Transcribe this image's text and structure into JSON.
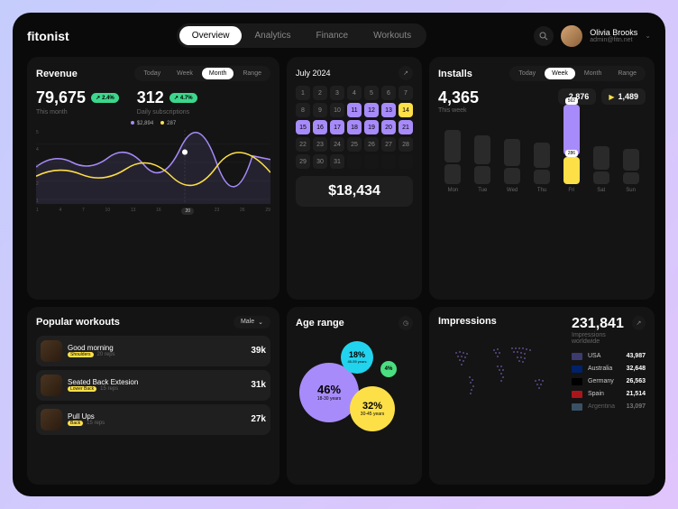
{
  "brand": "fitonist",
  "nav": {
    "items": [
      "Overview",
      "Analytics",
      "Finance",
      "Workouts"
    ],
    "active": 0
  },
  "user": {
    "name": "Olivia Brooks",
    "email": "admin@fitn.net"
  },
  "revenue": {
    "title": "Revenue",
    "tabs": [
      "Today",
      "Week",
      "Month",
      "Range"
    ],
    "active_tab": 2,
    "value": "79,675",
    "value_label": "This month",
    "value_change": "2.4%",
    "subs": "312",
    "subs_label": "Daily subscriptions",
    "subs_change": "4.7%",
    "legend_a": "$2,894",
    "legend_b": "287",
    "x_labels": [
      "1",
      "4",
      "7",
      "10",
      "13",
      "16",
      "20",
      "23",
      "26",
      "29"
    ]
  },
  "calendar": {
    "month": "July 2024",
    "days": [
      1,
      2,
      3,
      4,
      5,
      6,
      7,
      8,
      9,
      10,
      11,
      12,
      13,
      14,
      15,
      16,
      17,
      18,
      19,
      20,
      21,
      22,
      23,
      24,
      25,
      26,
      27,
      28,
      29,
      30,
      31
    ],
    "selected": [
      11,
      12,
      13,
      15,
      16,
      17,
      18,
      19,
      20,
      21
    ],
    "alt": [
      14
    ],
    "total": "$18,434"
  },
  "installs": {
    "title": "Installs",
    "tabs": [
      "Today",
      "Week",
      "Month",
      "Range"
    ],
    "active_tab": 1,
    "value": "4,365",
    "label": "This week",
    "apple": "2,876",
    "android": "1,489",
    "days": [
      "Mon",
      "Tue",
      "Wed",
      "Thu",
      "Fri",
      "Sat",
      "Sun"
    ],
    "top_val": "562",
    "bot_val": "286"
  },
  "workouts": {
    "title": "Popular workouts",
    "filter": "Male",
    "items": [
      {
        "name": "Good morning",
        "tag": "Shoulders",
        "reps": "20 reps",
        "count": "39k"
      },
      {
        "name": "Seated Back Extesion",
        "tag": "Lower Back",
        "reps": "15 reps",
        "count": "31k"
      },
      {
        "name": "Pull Ups",
        "tag": "Back",
        "reps": "15 reps",
        "count": "27k"
      }
    ]
  },
  "age": {
    "title": "Age range",
    "bubbles": [
      {
        "pct": "46%",
        "sub": "18-30 years"
      },
      {
        "pct": "32%",
        "sub": "30-45 years"
      },
      {
        "pct": "18%",
        "sub": "45-55 years"
      },
      {
        "pct": "4%",
        "sub": ""
      }
    ]
  },
  "impressions": {
    "title": "Impressions",
    "value": "231,841",
    "label": "Impressions worldwide",
    "countries": [
      {
        "name": "USA",
        "val": "43,987",
        "flag": "#3c3b6e"
      },
      {
        "name": "Australia",
        "val": "32,648",
        "flag": "#012169"
      },
      {
        "name": "Germany",
        "val": "26,563",
        "flag": "#000"
      },
      {
        "name": "Spain",
        "val": "21,514",
        "flag": "#aa151b"
      },
      {
        "name": "Argentina",
        "val": "13,097",
        "flag": "#74acdf"
      }
    ]
  },
  "chart_data": [
    {
      "type": "line",
      "title": "Revenue",
      "x": [
        1,
        4,
        7,
        10,
        13,
        16,
        20,
        23,
        26,
        29
      ],
      "series": [
        {
          "name": "$2,894",
          "values": [
            3.2,
            2.8,
            3.5,
            2.9,
            3.8,
            3.2,
            4.1,
            3.4,
            3.9,
            3.3
          ]
        },
        {
          "name": "287",
          "values": [
            2.9,
            3.3,
            2.7,
            3.4,
            2.8,
            3.6,
            3.0,
            3.7,
            2.9,
            3.5
          ]
        }
      ],
      "ylim": [
        1,
        5
      ]
    },
    {
      "type": "bar",
      "title": "Installs",
      "categories": [
        "Mon",
        "Tue",
        "Wed",
        "Thu",
        "Fri",
        "Sat",
        "Sun"
      ],
      "series": [
        {
          "name": "apple",
          "values": [
            420,
            380,
            340,
            310,
            562,
            280,
            260
          ]
        },
        {
          "name": "android",
          "values": [
            210,
            190,
            180,
            160,
            286,
            150,
            140
          ]
        }
      ]
    },
    {
      "type": "pie",
      "title": "Age range",
      "categories": [
        "18-30 years",
        "30-45 years",
        "45-55 years",
        "other"
      ],
      "values": [
        46,
        32,
        18,
        4
      ]
    }
  ]
}
